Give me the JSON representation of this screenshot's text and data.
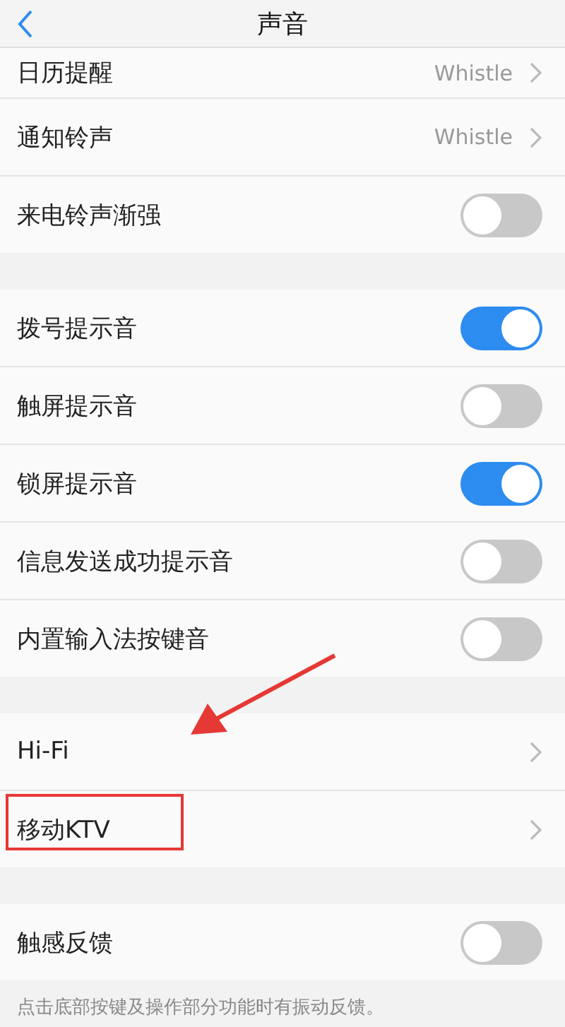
{
  "header": {
    "title": "声音"
  },
  "groups": [
    {
      "rows": [
        {
          "kind": "value",
          "label": "日历提醒",
          "value": "Whistle",
          "partial": true
        },
        {
          "kind": "value",
          "label": "通知铃声",
          "value": "Whistle"
        },
        {
          "kind": "toggle",
          "label": "来电铃声渐强",
          "on": false
        }
      ]
    },
    {
      "rows": [
        {
          "kind": "toggle",
          "label": "拨号提示音",
          "on": true
        },
        {
          "kind": "toggle",
          "label": "触屏提示音",
          "on": false
        },
        {
          "kind": "toggle",
          "label": "锁屏提示音",
          "on": true
        },
        {
          "kind": "toggle",
          "label": "信息发送成功提示音",
          "on": false
        },
        {
          "kind": "toggle",
          "label": "内置输入法按键音",
          "on": false
        }
      ]
    },
    {
      "rows": [
        {
          "kind": "link",
          "label": "Hi-Fi",
          "arrow_pointing": true
        },
        {
          "kind": "link",
          "label": "移动KTV",
          "highlighted": true
        }
      ]
    },
    {
      "rows": [
        {
          "kind": "toggle",
          "label": "触感反馈",
          "on": false
        }
      ]
    }
  ],
  "footer_note": "点击底部按键及操作部分功能时有振动反馈。"
}
